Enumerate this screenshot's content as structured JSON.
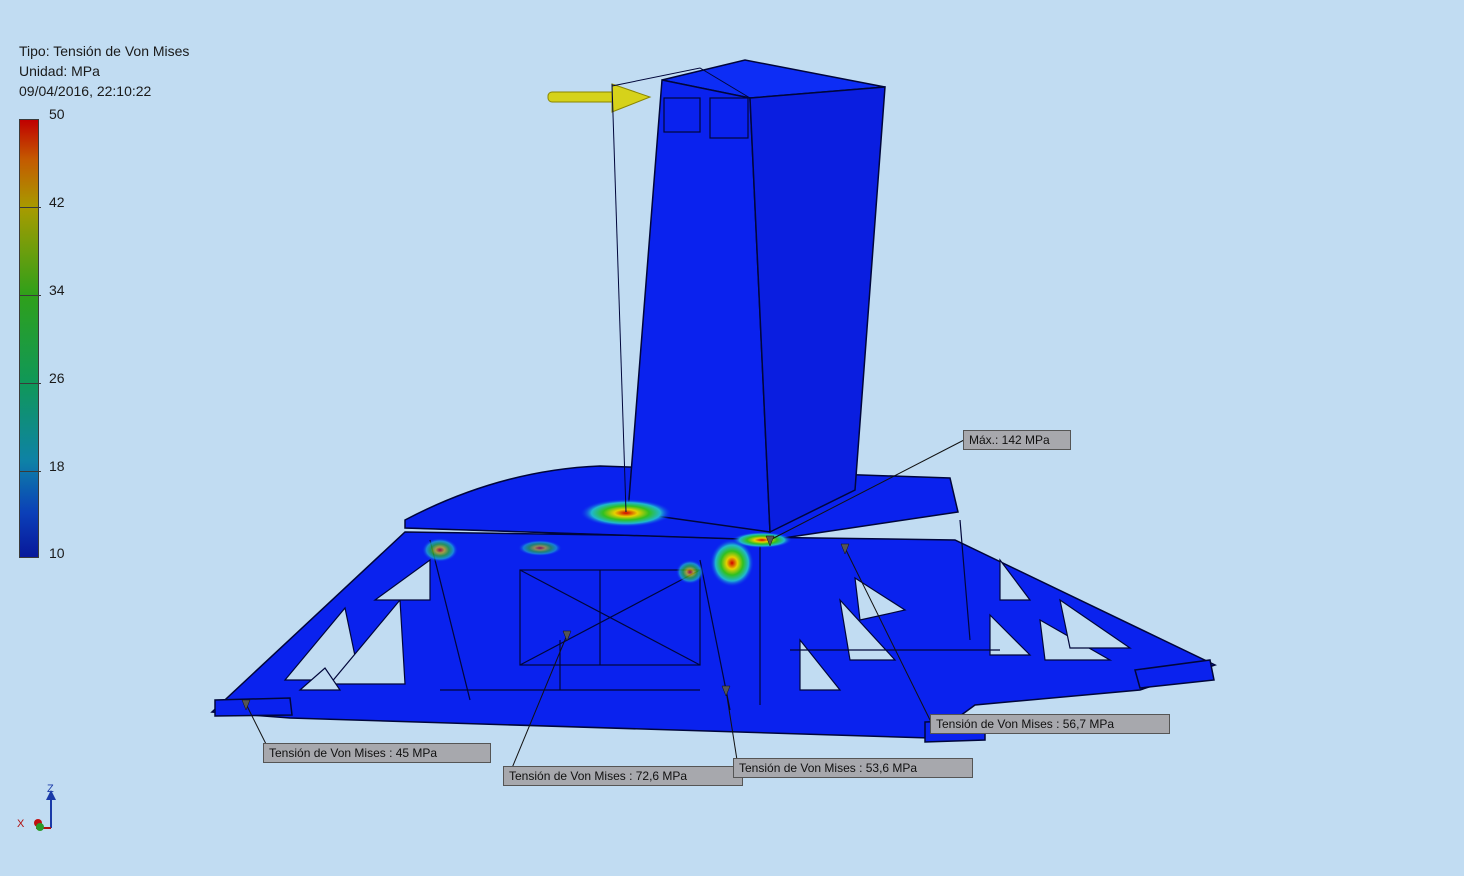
{
  "result_info": {
    "type_line": "Tipo: Tensión de Von Mises",
    "unit_line": "Unidad: MPa",
    "datetime": "09/04/2016, 22:10:22"
  },
  "color_scale": {
    "labels": [
      "50",
      "42",
      "34",
      "26",
      "18",
      "10"
    ],
    "colors": [
      "#c00000",
      "#a89b00",
      "#2fa01a",
      "#109858",
      "#0e82a6",
      "#08189a"
    ]
  },
  "probes": [
    {
      "text": "Máx.: 142 MPa"
    },
    {
      "text": "Tensión de Von Mises : 56,7 MPa"
    },
    {
      "text": "Tensión de Von Mises : 45 MPa"
    },
    {
      "text": "Tensión de Von Mises : 72,6 MPa"
    },
    {
      "text": "Tensión de Von Mises : 53,6 MPa"
    }
  ],
  "axis_triad": {
    "z_label": "Z",
    "x_label": "X"
  },
  "colors": {
    "background": "#c1dcf2",
    "model_blue": "#0a22ee",
    "load_arrow": "#d6d21a"
  }
}
